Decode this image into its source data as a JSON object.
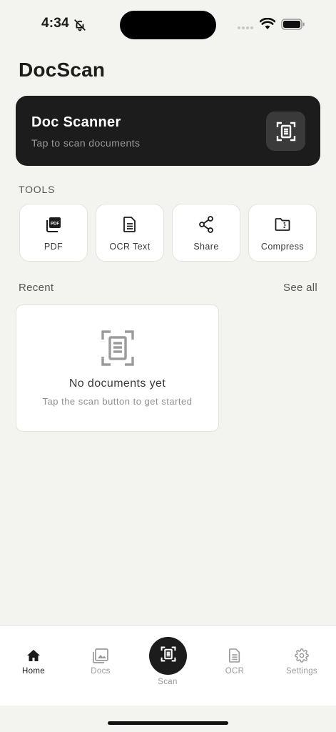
{
  "status_bar": {
    "time": "4:34",
    "icons": [
      "bell-slash-icon",
      "signal-icon",
      "wifi-icon",
      "battery-icon"
    ]
  },
  "app": {
    "title": "DocScan"
  },
  "scanner_card": {
    "title": "Doc Scanner",
    "subtitle": "Tap to scan documents",
    "icon": "scan-document-icon"
  },
  "tools": {
    "label": "TOOLS",
    "items": [
      {
        "label": "PDF",
        "icon": "pdf-icon"
      },
      {
        "label": "OCR Text",
        "icon": "document-text-icon"
      },
      {
        "label": "Share",
        "icon": "share-icon"
      },
      {
        "label": "Compress",
        "icon": "compress-folder-icon"
      }
    ]
  },
  "recent": {
    "label": "Recent",
    "see_all": "See all",
    "empty_title": "No documents yet",
    "empty_subtitle": "Tap the scan button to get started"
  },
  "tabbar": {
    "items": [
      {
        "label": "Home",
        "icon": "home-icon",
        "active": true
      },
      {
        "label": "Docs",
        "icon": "gallery-icon",
        "active": false
      },
      {
        "label": "Scan",
        "icon": "scan-document-icon",
        "active": false
      },
      {
        "label": "OCR",
        "icon": "document-text-icon",
        "active": false
      },
      {
        "label": "Settings",
        "icon": "gear-icon",
        "active": false
      }
    ]
  },
  "colors": {
    "background": "#f3f3ef",
    "card_dark": "#1c1c1c",
    "accent_text": "#1c1c1c",
    "muted_text": "#9a9a9a"
  }
}
